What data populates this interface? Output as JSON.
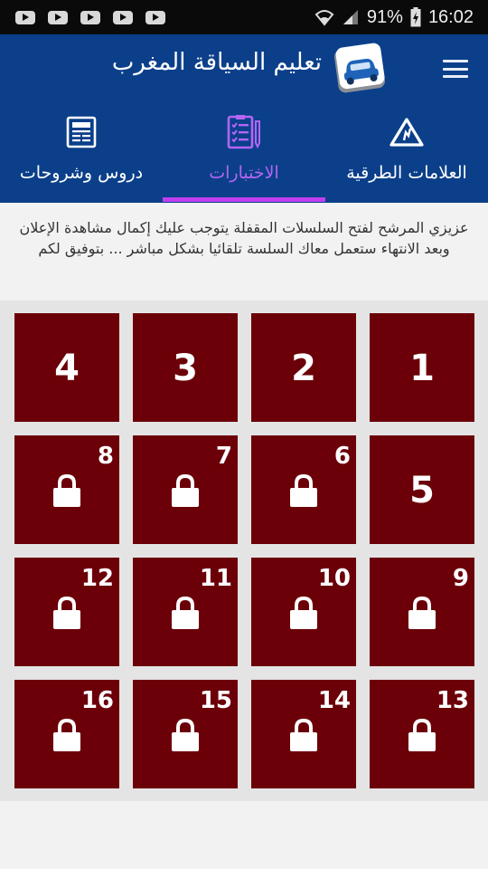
{
  "status_bar": {
    "notification_icons": [
      "youtube-icon",
      "youtube-icon",
      "youtube-icon",
      "youtube-icon",
      "youtube-icon"
    ],
    "battery_percent": "91%",
    "time": "16:02"
  },
  "app_bar": {
    "title": "تعليم السياقة المغرب",
    "menu_icon": "hamburger-menu-icon",
    "logo_icon": "car-logo-icon",
    "colors": {
      "background": "#0b3f8a",
      "accent": "#c03ff0"
    }
  },
  "tabs": [
    {
      "label": "العلامات الطرقية",
      "icon": "road-sign-icon",
      "selected": false
    },
    {
      "label": "الاختبارات",
      "icon": "checklist-icon",
      "selected": true
    },
    {
      "label": "دروس وشروحات",
      "icon": "newspaper-icon",
      "selected": false
    }
  ],
  "info_text": "عزيزي المرشح لفتح السلسلات المقفلة يتوجب عليك إكمال مشاهدة الإعلان وبعد الانتهاء ستعمل معاك السلسة تلقائيا بشكل مباشر ... بتوفيق لكم",
  "series": [
    {
      "number": "1",
      "locked": false
    },
    {
      "number": "2",
      "locked": false
    },
    {
      "number": "3",
      "locked": false
    },
    {
      "number": "4",
      "locked": false
    },
    {
      "number": "5",
      "locked": false
    },
    {
      "number": "6",
      "locked": true
    },
    {
      "number": "7",
      "locked": true
    },
    {
      "number": "8",
      "locked": true
    },
    {
      "number": "9",
      "locked": true
    },
    {
      "number": "10",
      "locked": true
    },
    {
      "number": "11",
      "locked": true
    },
    {
      "number": "12",
      "locked": true
    },
    {
      "number": "13",
      "locked": true
    },
    {
      "number": "14",
      "locked": true
    },
    {
      "number": "15",
      "locked": true
    },
    {
      "number": "16",
      "locked": true
    }
  ],
  "tile_color": "#6b0008"
}
